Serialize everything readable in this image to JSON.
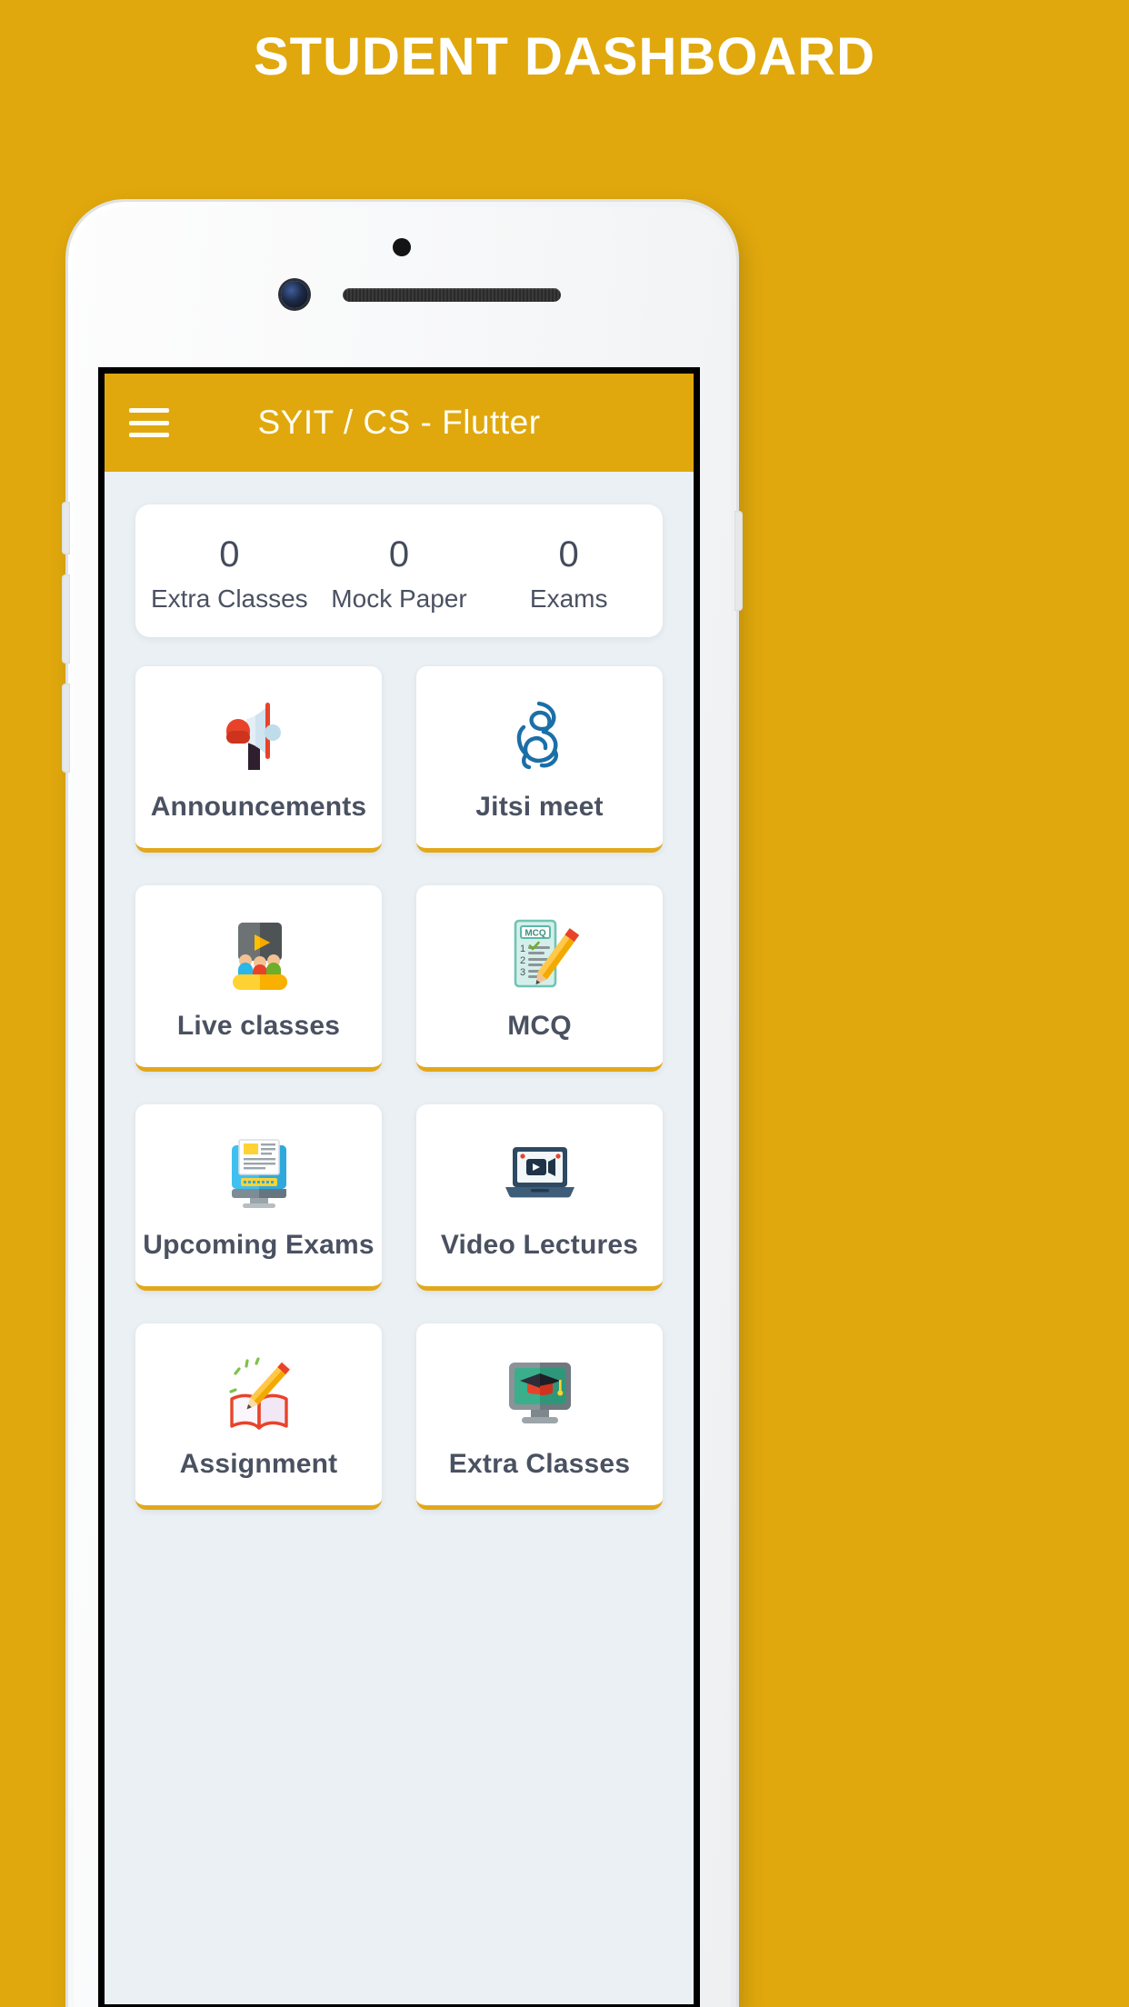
{
  "poster": {
    "title": "STUDENT DASHBOARD",
    "background_color": "#E0A80D",
    "title_color": "#FFFFFF"
  },
  "app": {
    "appbar": {
      "title": "SYIT / CS - Flutter",
      "menu_icon": "hamburger-menu-icon",
      "background_color": "#E0A80D",
      "text_color": "#FFFDF3"
    },
    "screen_background": "#EAF0F3",
    "accent_color": "#E2A81A",
    "stats": {
      "items": [
        {
          "value": "0",
          "label": "Extra Classes"
        },
        {
          "value": "0",
          "label": "Mock Paper"
        },
        {
          "value": "0",
          "label": "Exams"
        }
      ]
    },
    "menu_tiles": [
      {
        "label": "Announcements",
        "icon": "megaphone-icon"
      },
      {
        "label": "Jitsi meet",
        "icon": "jitsi-logo-icon"
      },
      {
        "label": "Live classes",
        "icon": "live-class-screen-icon"
      },
      {
        "label": "MCQ",
        "icon": "mcq-checklist-pencil-icon"
      },
      {
        "label": "Upcoming Exams",
        "icon": "desktop-monitor-paper-icon"
      },
      {
        "label": "Video Lectures",
        "icon": "laptop-video-icon"
      },
      {
        "label": "Assignment",
        "icon": "book-pencil-icon"
      },
      {
        "label": "Extra Classes",
        "icon": "monitor-graduation-cap-icon"
      }
    ]
  }
}
